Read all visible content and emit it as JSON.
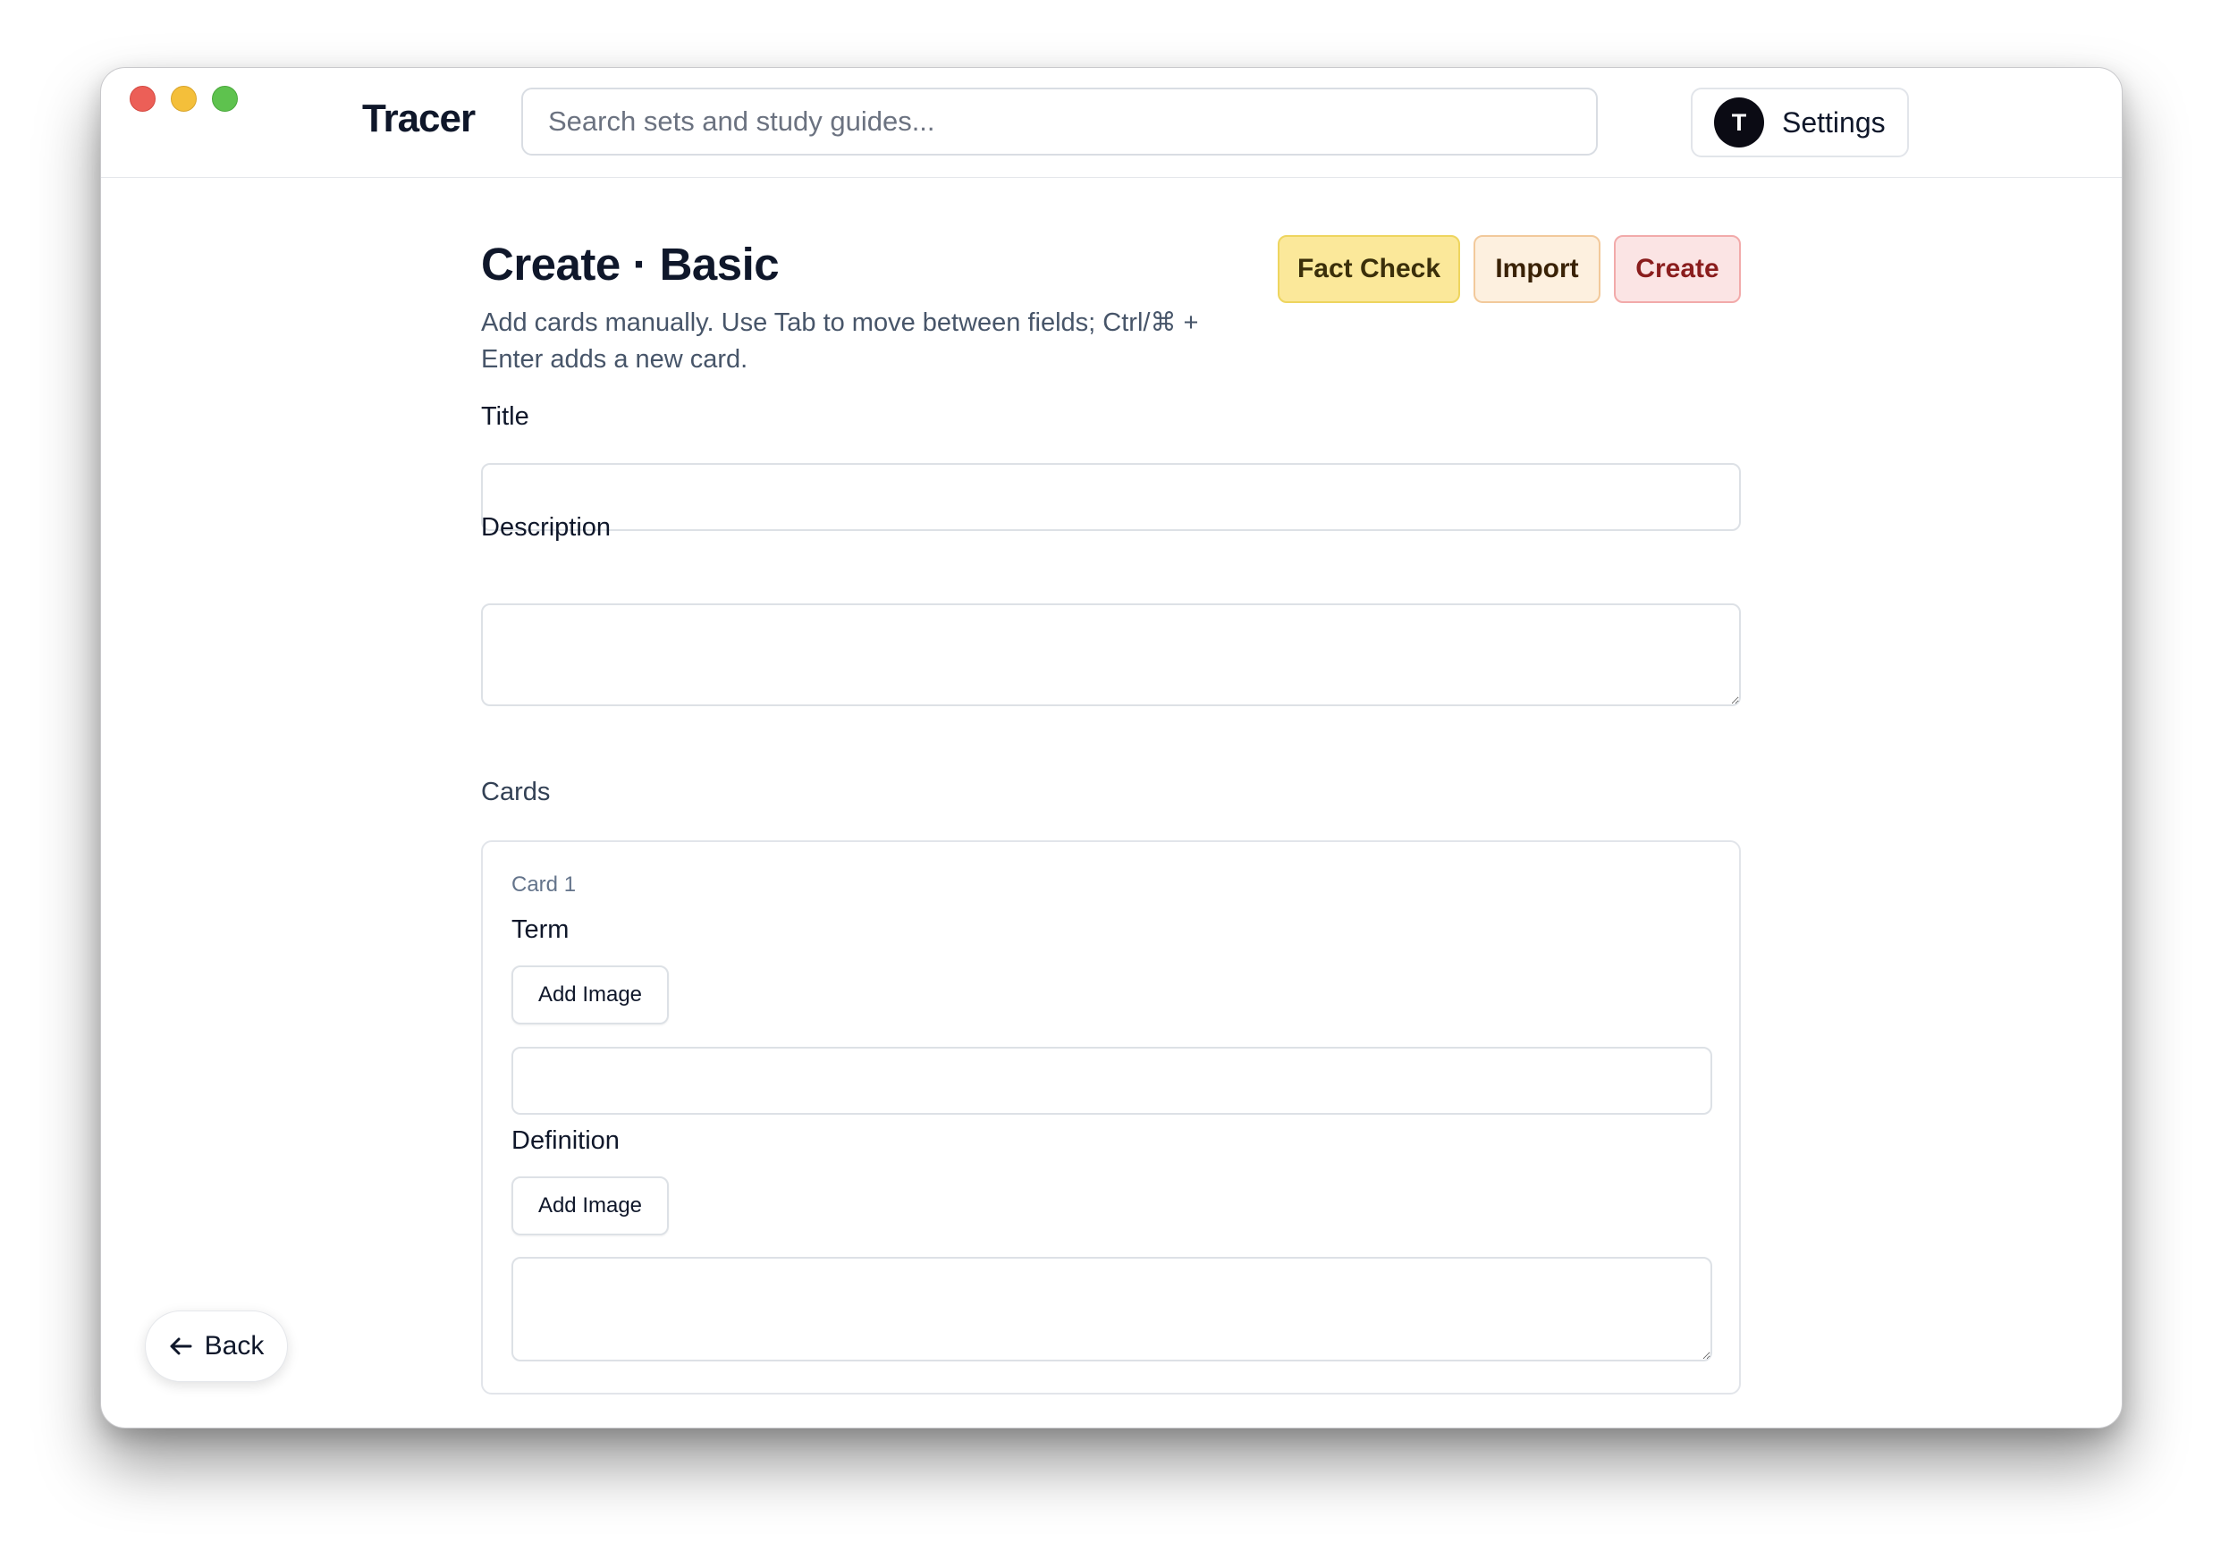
{
  "app": {
    "brand": "Tracer"
  },
  "header": {
    "search_placeholder": "Search sets and study guides...",
    "avatar_initial": "T",
    "settings_label": "Settings"
  },
  "page": {
    "title": "Create · Basic",
    "subtitle": "Add cards manually. Use Tab to move between fields; Ctrl/⌘ + Enter adds a new card.",
    "actions": {
      "fact_check": "Fact Check",
      "import": "Import",
      "create": "Create"
    }
  },
  "form": {
    "title_label": "Title",
    "title_value": "",
    "description_label": "Description",
    "description_value": ""
  },
  "cards": {
    "section_label": "Cards",
    "items": [
      {
        "number_label": "Card 1",
        "term_label": "Term",
        "term_value": "",
        "definition_label": "Definition",
        "definition_value": "",
        "add_image_label": "Add Image"
      }
    ]
  },
  "footer": {
    "back_label": "Back"
  },
  "colors": {
    "fact_check_bg": "#fbe89a",
    "import_bg": "#fdf0df",
    "create_bg": "#fbe4e4",
    "create_text": "#8a1d1d",
    "traffic_close": "#ec5f57",
    "traffic_minimize": "#f4bf3a",
    "traffic_maximize": "#5ec24e"
  },
  "icons": {
    "back": "arrow-left-icon",
    "textarea_resize": "resize-handle-icon"
  }
}
